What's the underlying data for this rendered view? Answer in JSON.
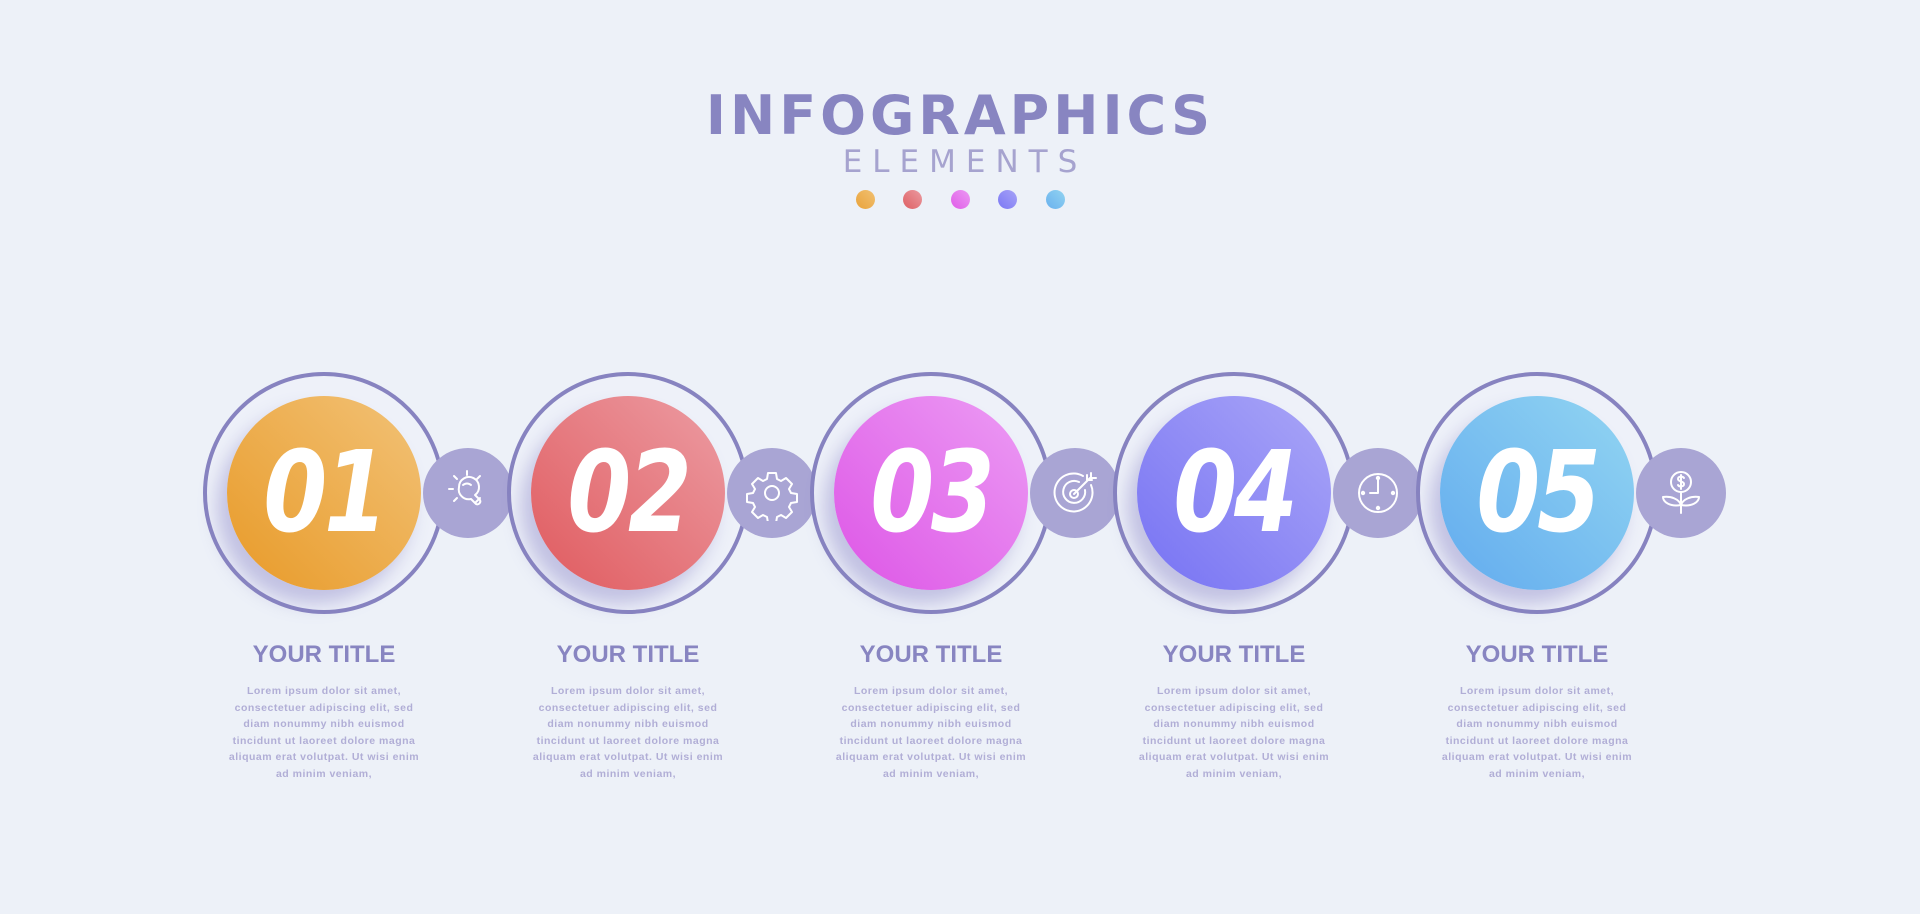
{
  "header": {
    "title": "INFOGRAPHICS",
    "subtitle": "ELEMENTS",
    "dots": [
      {
        "name": "orange",
        "from": "#e9a33b",
        "to": "#f1c071"
      },
      {
        "name": "red",
        "from": "#de6064",
        "to": "#eb9aa0"
      },
      {
        "name": "magenta",
        "from": "#e05ce8",
        "to": "#eb99f3"
      },
      {
        "name": "violet",
        "from": "#7b78f4",
        "to": "#a7a3f7"
      },
      {
        "name": "blue",
        "from": "#6ab1ee",
        "to": "#91d3f1"
      }
    ]
  },
  "colors": {
    "background": "#edf1f8",
    "ring": "#8783c0",
    "icon_bubble": "#a9a5d4",
    "title_text": "#8885c1",
    "body_text": "#b1aed6"
  },
  "steps": [
    {
      "number": "01",
      "color_from": "#e89a28",
      "color_to": "#f2c277",
      "icon": "lightbulb-icon",
      "title": "YOUR TITLE",
      "body": [
        "Lorem ipsum dolor sit amet,",
        "consectetuer adipiscing elit, sed",
        "diam nonummy nibh euismod",
        "tincidunt ut laoreet dolore magna",
        "aliquam erat volutpat. Ut wisi enim",
        "ad minim veniam,"
      ]
    },
    {
      "number": "02",
      "color_from": "#e05a5e",
      "color_to": "#ec9ca3",
      "icon": "gear-icon",
      "title": "YOUR TITLE",
      "body": [
        "Lorem ipsum dolor sit amet,",
        "consectetuer adipiscing elit, sed",
        "diam nonummy nibh euismod",
        "tincidunt ut laoreet dolore magna",
        "aliquam erat volutpat. Ut wisi enim",
        "ad minim veniam,"
      ]
    },
    {
      "number": "03",
      "color_from": "#dd55e6",
      "color_to": "#ec9cf4",
      "icon": "target-icon",
      "title": "YOUR TITLE",
      "body": [
        "Lorem ipsum dolor sit amet,",
        "consectetuer adipiscing elit, sed",
        "diam nonummy nibh euismod",
        "tincidunt ut laoreet dolore magna",
        "aliquam erat volutpat. Ut wisi enim",
        "ad minim veniam,"
      ]
    },
    {
      "number": "04",
      "color_from": "#7672f3",
      "color_to": "#aaa6f7",
      "icon": "clock-icon",
      "title": "YOUR TITLE",
      "body": [
        "Lorem ipsum dolor sit amet,",
        "consectetuer adipiscing elit, sed",
        "diam nonummy nibh euismod",
        "tincidunt ut laoreet dolore magna",
        "aliquam erat volutpat. Ut wisi enim",
        "ad minim veniam,"
      ]
    },
    {
      "number": "05",
      "color_from": "#62abee",
      "color_to": "#92d5f2",
      "icon": "money-plant-icon",
      "title": "YOUR TITLE",
      "body": [
        "Lorem ipsum dolor sit amet,",
        "consectetuer adipiscing elit, sed",
        "diam nonummy nibh euismod",
        "tincidunt ut laoreet dolore magna",
        "aliquam erat volutpat. Ut wisi enim",
        "ad minim veniam,"
      ]
    }
  ]
}
